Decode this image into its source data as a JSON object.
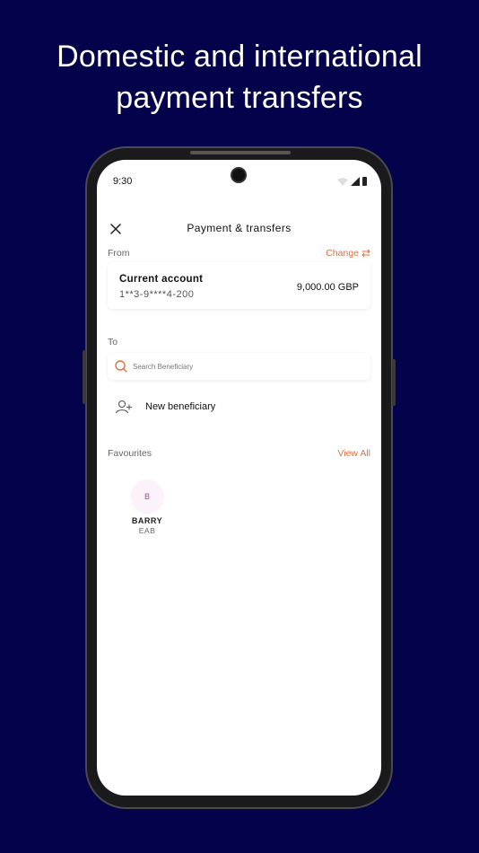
{
  "headline": {
    "line1": "Domestic and international",
    "line2": "payment transfers"
  },
  "status_bar": {
    "time": "9:30"
  },
  "screen": {
    "title": "Payment & transfers",
    "from_label": "From",
    "change_label": "Change",
    "account": {
      "name": "Current account",
      "number": "1**3-9****4-200",
      "balance": "9,000.00 GBP"
    },
    "to_label": "To",
    "search": {
      "placeholder": "Search Beneficiary",
      "value": ""
    },
    "new_beneficiary_label": "New beneficiary",
    "favourites_label": "Favourites",
    "view_all_label": "View All",
    "favourites": [
      {
        "initial": "B",
        "name": "BARRY",
        "bank": "EAB"
      }
    ]
  },
  "colors": {
    "background": "#03024a",
    "accent": "#e0703f",
    "avatar_bg": "#fbf2fa",
    "avatar_text": "#a04a96"
  },
  "icons": [
    "close-icon",
    "swap-icon",
    "search-icon",
    "add-user-icon",
    "wifi-icon",
    "signal-icon",
    "battery-icon"
  ]
}
